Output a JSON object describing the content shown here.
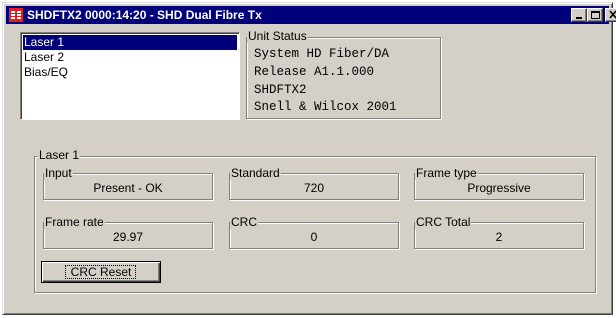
{
  "window": {
    "title": "SHDFTX2 0000:14:20 - SHD Dual Fibre Tx",
    "title_bar_color": "#00007a",
    "app_icon": "red-fibre-app-icon",
    "controls": [
      "minimize",
      "maximize",
      "close"
    ]
  },
  "channel_list": {
    "items": [
      {
        "label": "Laser 1",
        "selected": true
      },
      {
        "label": "Laser 2",
        "selected": false
      },
      {
        "label": "Bias/EQ",
        "selected": false
      }
    ]
  },
  "unit_status": {
    "legend": "Unit Status",
    "lines": [
      "System HD Fiber/DA",
      "Release A1.1.000",
      "SHDFTX2",
      "Snell & Wilcox 2001"
    ]
  },
  "laser_group": {
    "legend": "Laser 1",
    "fields": {
      "input": {
        "label": "Input",
        "value": "Present - OK"
      },
      "standard": {
        "label": "Standard",
        "value": "720"
      },
      "frame_type": {
        "label": "Frame type",
        "value": "Progressive"
      },
      "frame_rate": {
        "label": "Frame rate",
        "value": "29.97"
      },
      "crc": {
        "label": "CRC",
        "value": "0"
      },
      "crc_total": {
        "label": "CRC Total",
        "value": "2"
      }
    },
    "reset_button": "CRC Reset"
  }
}
